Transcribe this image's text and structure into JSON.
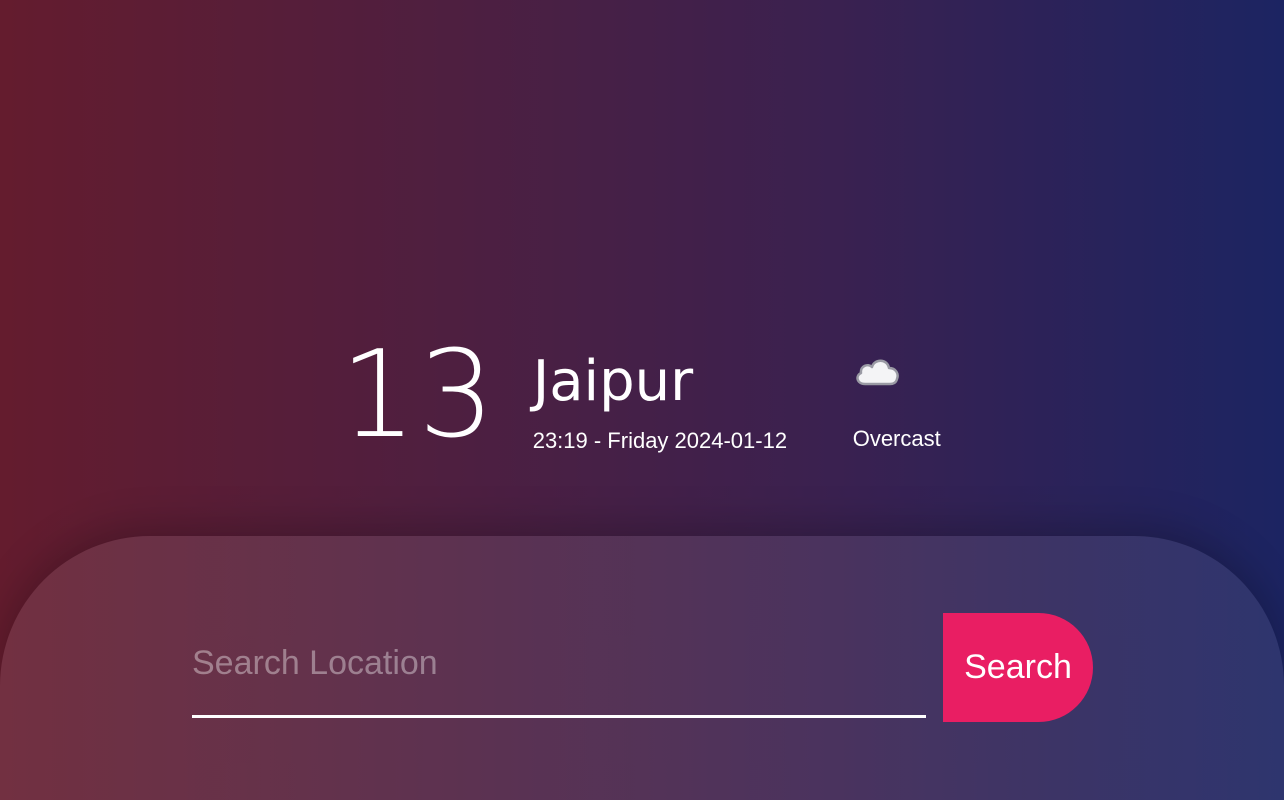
{
  "weather": {
    "temperature": "13",
    "city": "Jaipur",
    "datetime": "23:19 - Friday 2024-01-12",
    "condition": "Overcast",
    "condition_icon": "cloud-icon"
  },
  "search": {
    "placeholder": "Search Location",
    "value": "",
    "button_label": "Search"
  },
  "colors": {
    "gradient_left": "#641c2e",
    "gradient_right": "#1c2462",
    "accent": "#e91e63",
    "text": "#ffffff"
  }
}
